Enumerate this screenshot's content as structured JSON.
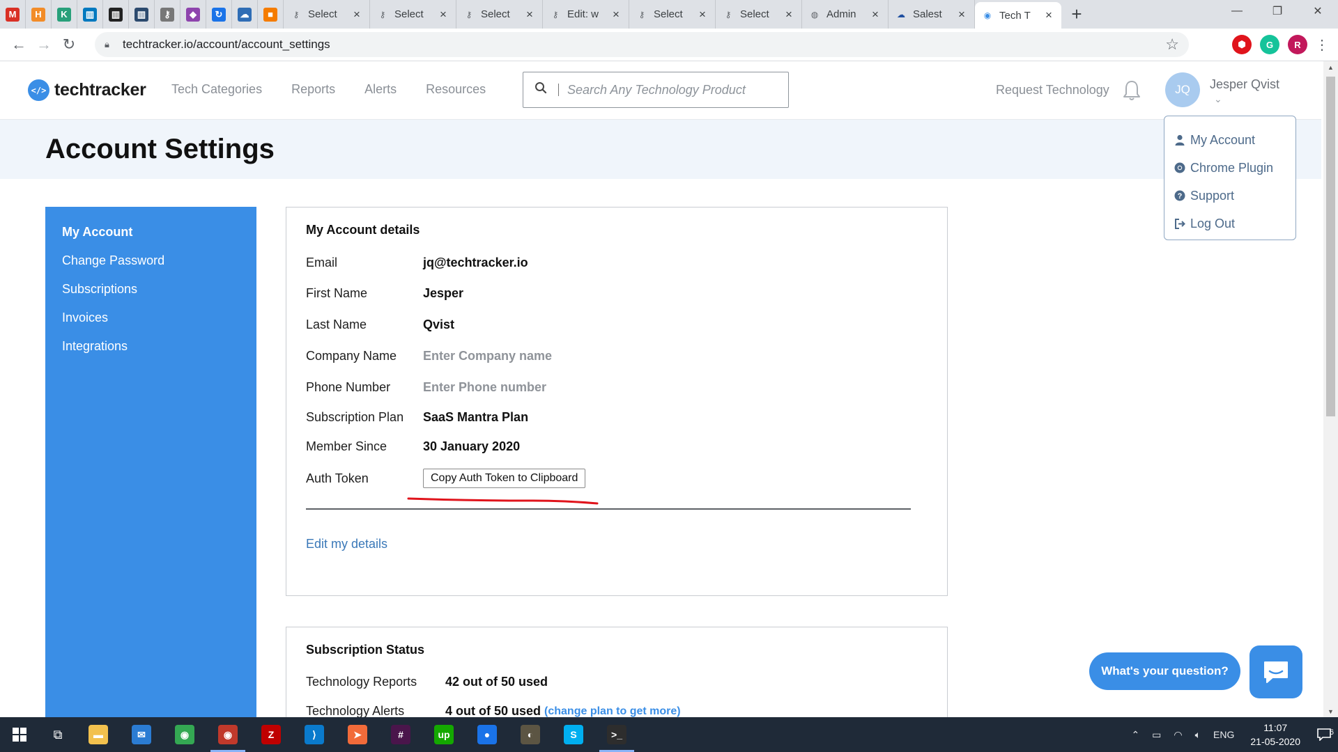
{
  "browser": {
    "pinned_tabs": [
      {
        "icon": "gmail-icon",
        "glyph": "M",
        "color": "#d93025"
      },
      {
        "icon": "hubstaff-icon",
        "glyph": "H",
        "color": "#f28c28"
      },
      {
        "icon": "kajabi-icon",
        "glyph": "K",
        "color": "#28a07a"
      },
      {
        "icon": "trello-icon",
        "glyph": "▥",
        "color": "#0079bf"
      },
      {
        "icon": "notion-icon",
        "glyph": "▥",
        "color": "#222222"
      },
      {
        "icon": "board-icon",
        "glyph": "▥",
        "color": "#2c4a6e"
      },
      {
        "icon": "key-icon",
        "glyph": "⚷",
        "color": "#777777"
      },
      {
        "icon": "figma-icon",
        "glyph": "◆",
        "color": "#8e44ad"
      },
      {
        "icon": "sync-icon",
        "glyph": "↻",
        "color": "#1a73e8"
      },
      {
        "icon": "cloud-icon",
        "glyph": "☁",
        "color": "#2f6db5"
      },
      {
        "icon": "box-icon",
        "glyph": "■",
        "color": "#f57c00"
      }
    ],
    "tabs": [
      {
        "title": "Select",
        "icon": "key-icon"
      },
      {
        "title": "Select",
        "icon": "key-icon"
      },
      {
        "title": "Select",
        "icon": "key-icon"
      },
      {
        "title": "Edit: w",
        "icon": "key-icon"
      },
      {
        "title": "Select",
        "icon": "key-icon"
      },
      {
        "title": "Select",
        "icon": "key-icon"
      },
      {
        "title": "Admin",
        "icon": "wordpress-icon"
      },
      {
        "title": "Salest",
        "icon": "salesforce-icon"
      },
      {
        "title": "Tech T",
        "icon": "techtracker-icon"
      }
    ],
    "url": "techtracker.io/account/account_settings"
  },
  "site": {
    "logo_text": "techtracker",
    "logo_mark": "</>",
    "nav": [
      "Tech Categories",
      "Reports",
      "Alerts",
      "Resources"
    ],
    "search_placeholder": "Search Any Technology Product",
    "request_label": "Request Technology",
    "user_initials": "JQ",
    "user_name": "Jesper Qvist",
    "dropdown": [
      {
        "label": "My Account",
        "icon": "user-icon"
      },
      {
        "label": "Chrome Plugin",
        "icon": "chrome-icon"
      },
      {
        "label": "Support",
        "icon": "question-icon"
      },
      {
        "label": "Log Out",
        "icon": "logout-icon"
      }
    ]
  },
  "page": {
    "title": "Account Settings",
    "sidebar": [
      {
        "label": "My Account",
        "active": true
      },
      {
        "label": "Change Password",
        "active": false
      },
      {
        "label": "Subscriptions",
        "active": false
      },
      {
        "label": "Invoices",
        "active": false
      },
      {
        "label": "Integrations",
        "active": false
      }
    ],
    "account_card": {
      "heading": "My Account details",
      "email_label": "Email",
      "email_value": "jq@techtracker.io",
      "first_name_label": "First Name",
      "first_name_value": "Jesper",
      "last_name_label": "Last Name",
      "last_name_value": "Qvist",
      "company_label": "Company Name",
      "company_placeholder": "Enter Company name",
      "phone_label": "Phone Number",
      "phone_placeholder": "Enter Phone number",
      "plan_label": "Subscription Plan",
      "plan_value": "SaaS Mantra Plan",
      "member_label": "Member Since",
      "member_value": "30 January 2020",
      "token_label": "Auth Token",
      "token_button": "Copy Auth Token to Clipboard",
      "edit_link": "Edit my details"
    },
    "subscription_card": {
      "heading": "Subscription Status",
      "reports_label": "Technology Reports",
      "reports_value": "42 out of 50 used",
      "alerts_label": "Technology Alerts",
      "alerts_value": "4 out of 50 used",
      "alerts_link": "(change plan to get more)"
    },
    "chat": {
      "bubble_text": "What's your question?"
    }
  },
  "colors": {
    "brand_blue": "#3a8ee6",
    "annotation_red": "#e0141c"
  },
  "taskbar": {
    "apps": [
      {
        "icon": "file-explorer-icon",
        "glyph": "▬",
        "color": "#f2c14e",
        "open": false
      },
      {
        "icon": "mail-icon",
        "glyph": "✉",
        "color": "#2b7cd3",
        "open": false
      },
      {
        "icon": "chrome-icon",
        "glyph": "◉",
        "color": "#34a853",
        "open": false
      },
      {
        "icon": "chrome-profile-icon",
        "glyph": "◉",
        "color": "#c0392b",
        "open": true
      },
      {
        "icon": "filezilla-icon",
        "glyph": "Z",
        "color": "#bf0000",
        "open": false
      },
      {
        "icon": "vscode-icon",
        "glyph": "⟩",
        "color": "#0a7acc",
        "open": false
      },
      {
        "icon": "postman-icon",
        "glyph": "➤",
        "color": "#f26b3a",
        "open": false
      },
      {
        "icon": "slack-icon",
        "glyph": "#",
        "color": "#4a154b",
        "open": false
      },
      {
        "icon": "upwork-icon",
        "glyph": "up",
        "color": "#14a800",
        "open": false
      },
      {
        "icon": "maps-icon",
        "glyph": "●",
        "color": "#1a73e8",
        "open": false
      },
      {
        "icon": "gimp-icon",
        "glyph": "◐",
        "color": "#5c5543",
        "open": false
      },
      {
        "icon": "skype-icon",
        "glyph": "S",
        "color": "#00aff0",
        "open": false
      },
      {
        "icon": "terminal-icon",
        "glyph": ">_",
        "color": "#2d2d2d",
        "open": true
      }
    ],
    "language": "ENG",
    "time": "11:07",
    "date": "21-05-2020",
    "notifications": "6"
  }
}
